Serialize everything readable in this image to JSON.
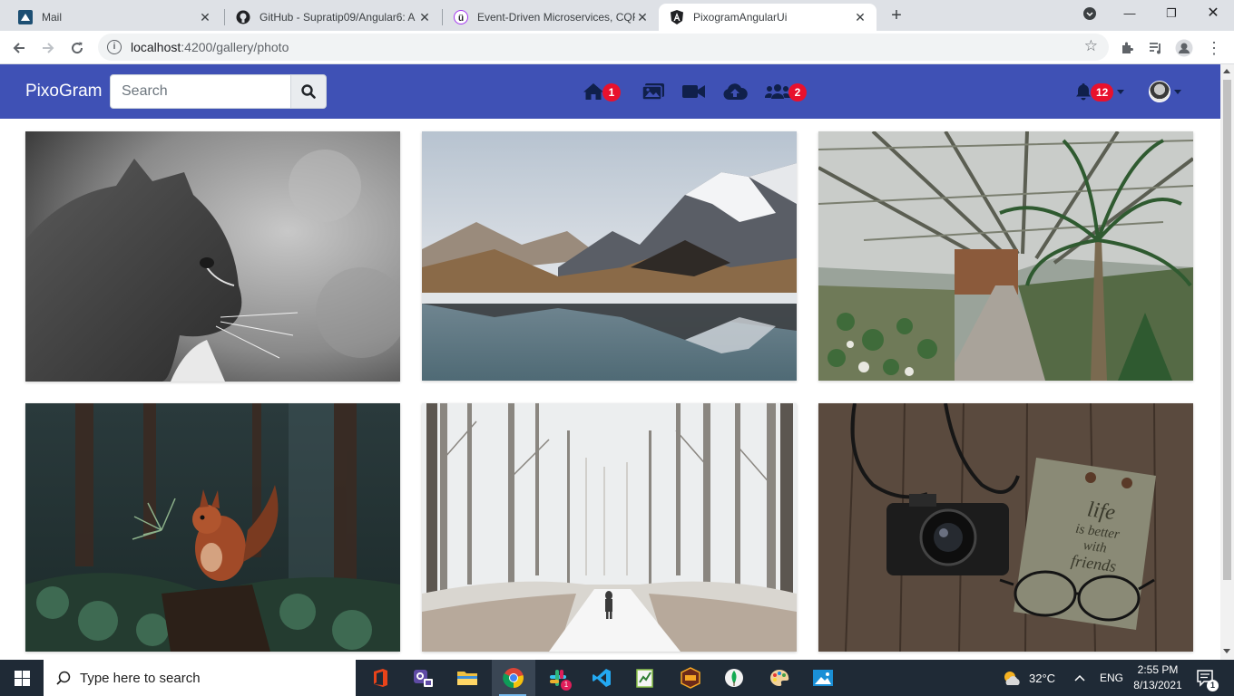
{
  "browser": {
    "tabs": [
      {
        "title": "Mail",
        "active": false
      },
      {
        "title": "GitHub - Supratip09/Angular6: A",
        "active": false
      },
      {
        "title": "Event-Driven Microservices, CQR",
        "active": false
      },
      {
        "title": "PixogramAngularUi",
        "active": true
      }
    ],
    "url_host": "localhost",
    "url_path": ":4200/gallery/photo"
  },
  "app": {
    "brand": "PixoGram",
    "search_placeholder": "Search",
    "nav": {
      "home_badge": "1",
      "followers_badge": "2",
      "notifications_badge": "12"
    },
    "colors": {
      "navbar": "#3f51b5",
      "badge": "#e8112d",
      "icon": "#10204b"
    }
  },
  "gallery": {
    "photos": [
      {
        "subject": "black-and-white cat portrait"
      },
      {
        "subject": "mountain lake reflection"
      },
      {
        "subject": "greenhouse with cacti"
      },
      {
        "subject": "red squirrel in forest"
      },
      {
        "subject": "person walking on snowy forest road"
      },
      {
        "subject": "camera and glasses on wooden table"
      }
    ],
    "notebook_text": [
      "life",
      "is better",
      "with",
      "friends"
    ]
  },
  "taskbar": {
    "search_placeholder": "Type here to search",
    "temperature": "32°C",
    "language": "ENG",
    "time": "2:55 PM",
    "date": "8/13/2021",
    "chat_badge": "1",
    "notification_badge": "1"
  }
}
